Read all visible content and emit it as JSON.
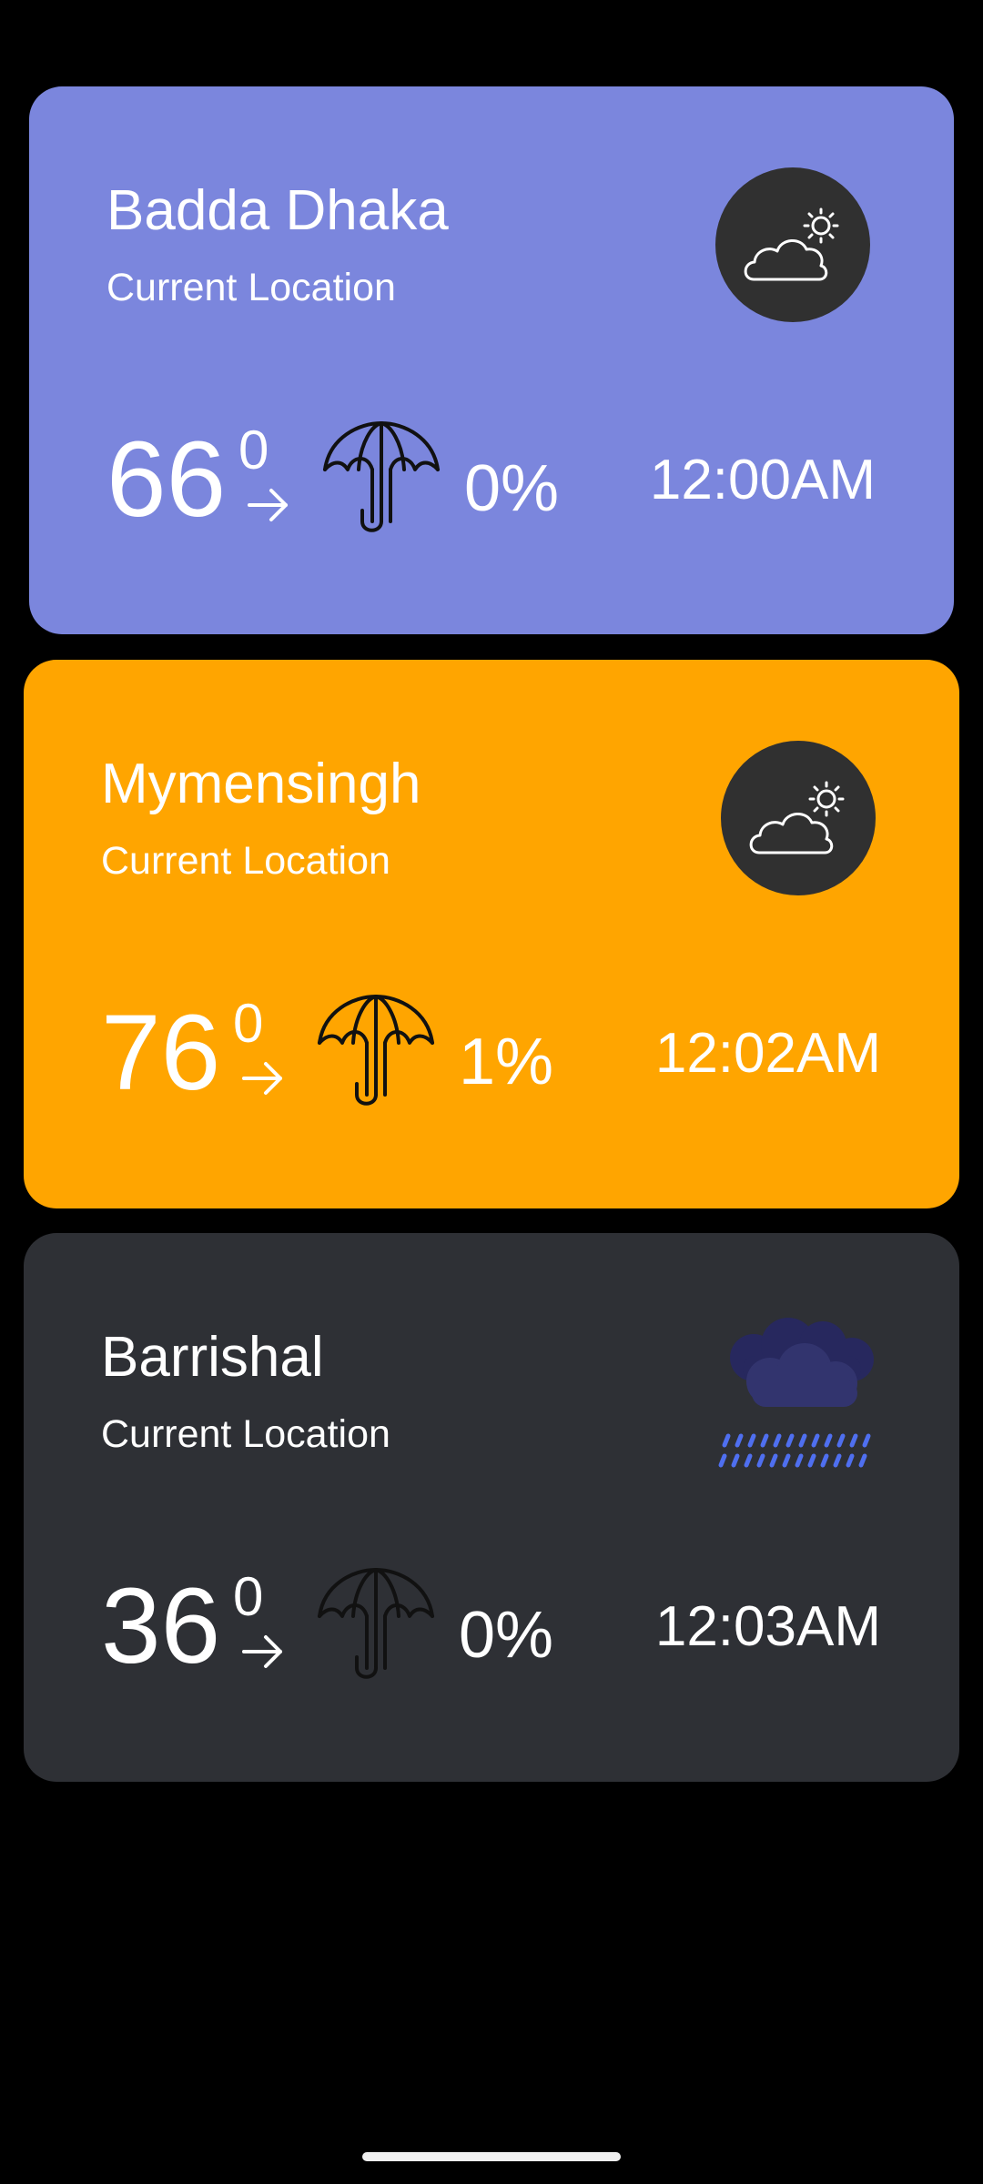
{
  "colors": {
    "page_background": "#000000",
    "card_1_background": "#7b86dd",
    "card_2_background": "#ffa500",
    "card_3_background": "#2e3035",
    "text": "#ffffff",
    "icon_badge": "#303030",
    "rain_cloud": "#27285e",
    "rain_drops": "#4f6ff0"
  },
  "cards": [
    {
      "city": "Badda Dhaka",
      "subtitle": "Current Location",
      "temperature": "66",
      "degree_symbol": "0",
      "precipitation": "0%",
      "time": "12:00AM",
      "weather_icon": "partly-cloudy-icon"
    },
    {
      "city": "Mymensingh",
      "subtitle": "Current Location",
      "temperature": "76",
      "degree_symbol": "0",
      "precipitation": "1%",
      "time": "12:02AM",
      "weather_icon": "partly-cloudy-icon"
    },
    {
      "city": "Barrishal",
      "subtitle": "Current Location",
      "temperature": "36",
      "degree_symbol": "0",
      "precipitation": "0%",
      "time": "12:03AM",
      "weather_icon": "rain-cloud-icon"
    }
  ],
  "icons": {
    "arrow": "arrow-right-icon",
    "umbrella": "umbrella-icon"
  }
}
